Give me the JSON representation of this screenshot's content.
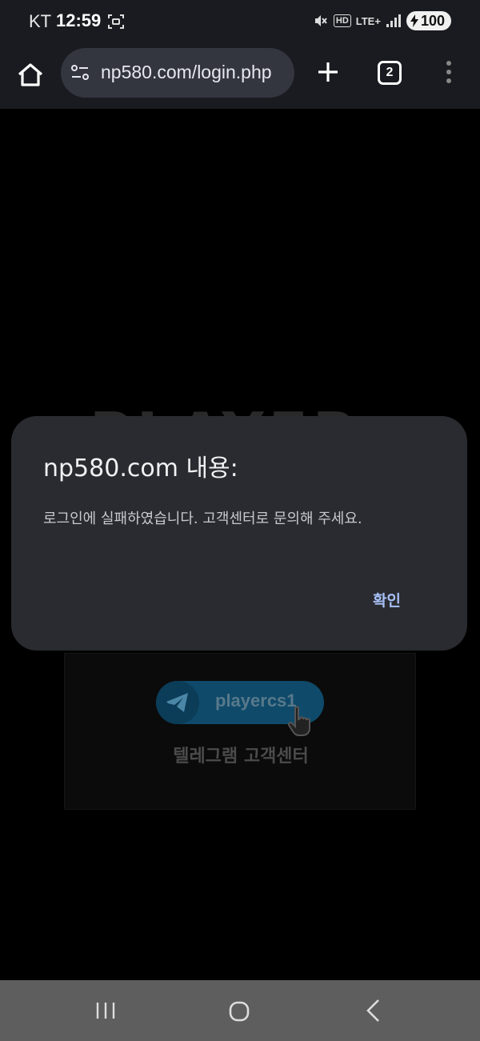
{
  "status_bar": {
    "carrier": "KT",
    "time": "12:59",
    "hd": "HD",
    "network": "LTE+",
    "battery": "100"
  },
  "browser": {
    "url": "np580.com/login.php",
    "tab_count": "2",
    "icons": [
      "home-icon",
      "site-settings-icon",
      "plus-icon",
      "tabs-icon",
      "more-vert-icon"
    ]
  },
  "page": {
    "brand": "PLAYER",
    "telegram_handle": "playercs1",
    "support_label": "텔레그램 고객센터"
  },
  "dialog": {
    "title": "np580.com 내용:",
    "message": "로그인에 실패하였습니다. 고객센터로 문의해 주세요.",
    "ok_label": "확인"
  },
  "colors": {
    "dialog_bg": "#2a2b30",
    "accent": "#a7c0f7",
    "toolbar_bg": "#1a1b20"
  }
}
